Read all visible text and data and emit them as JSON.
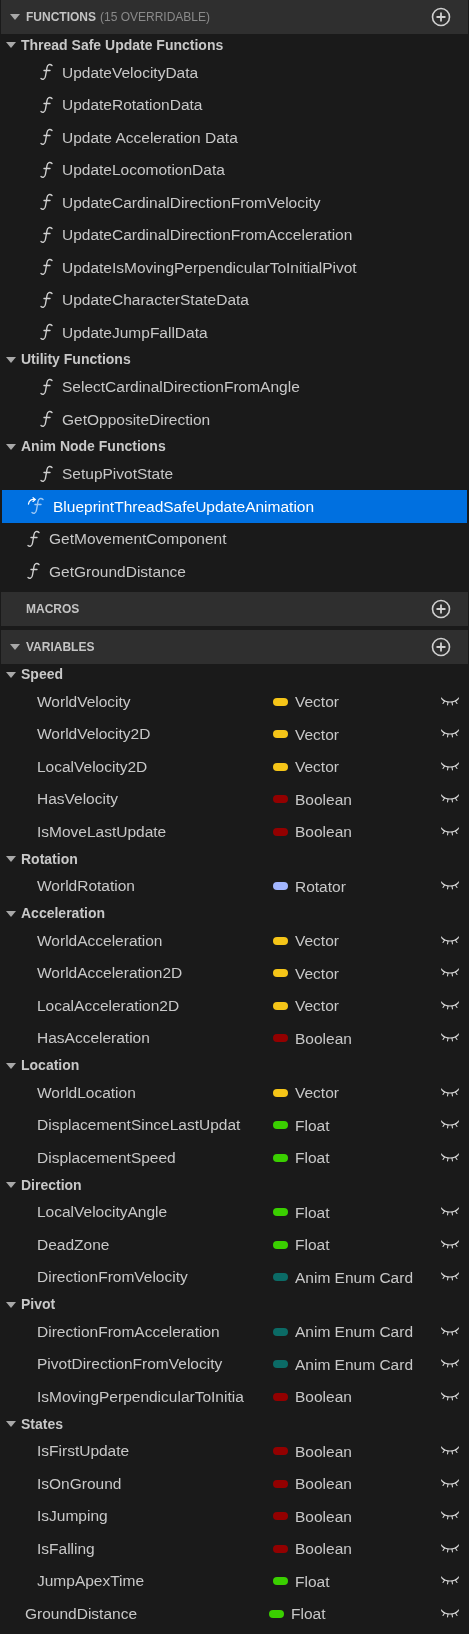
{
  "sections": [
    {
      "kind": "functions",
      "title": "FUNCTIONS",
      "note": "(15 OVERRIDABLE)",
      "expanded": true,
      "categories": [
        {
          "name": "Thread Safe Update Functions",
          "expanded": true,
          "items": [
            {
              "name": "UpdateVelocityData",
              "kind": "function",
              "selected": false
            },
            {
              "name": "UpdateRotationData",
              "kind": "function",
              "selected": false
            },
            {
              "name": "Update Acceleration Data",
              "kind": "function",
              "selected": false
            },
            {
              "name": "UpdateLocomotionData",
              "kind": "function",
              "selected": false
            },
            {
              "name": "UpdateCardinalDirectionFromVelocity",
              "kind": "function",
              "selected": false
            },
            {
              "name": "UpdateCardinalDirectionFromAcceleration",
              "kind": "function",
              "selected": false
            },
            {
              "name": "UpdateIsMovingPerpendicularToInitialPivot",
              "kind": "function",
              "selected": false
            },
            {
              "name": "UpdateCharacterStateData",
              "kind": "function",
              "selected": false
            },
            {
              "name": "UpdateJumpFallData",
              "kind": "function",
              "selected": false
            }
          ]
        },
        {
          "name": "Utility Functions",
          "expanded": true,
          "items": [
            {
              "name": "SelectCardinalDirectionFromAngle",
              "kind": "function",
              "selected": false
            },
            {
              "name": "GetOppositeDirection",
              "kind": "function",
              "selected": false
            }
          ]
        },
        {
          "name": "Anim Node Functions",
          "expanded": true,
          "items": [
            {
              "name": "SetupPivotState",
              "kind": "function",
              "selected": false
            }
          ]
        }
      ],
      "items": [
        {
          "name": "BlueprintThreadSafeUpdateAnimation",
          "kind": "override",
          "selected": true
        },
        {
          "name": "GetMovementComponent",
          "kind": "function",
          "selected": false
        },
        {
          "name": "GetGroundDistance",
          "kind": "function",
          "selected": false
        }
      ]
    },
    {
      "kind": "macros",
      "title": "MACROS",
      "expanded": false
    },
    {
      "kind": "variables",
      "title": "VARIABLES",
      "expanded": true,
      "categories": [
        {
          "name": "Speed",
          "expanded": true,
          "items": [
            {
              "name": "WorldVelocity",
              "type": "Vector",
              "color": "#f5c518"
            },
            {
              "name": "WorldVelocity2D",
              "type": "Vector",
              "color": "#f5c518"
            },
            {
              "name": "LocalVelocity2D",
              "type": "Vector",
              "color": "#f5c518"
            },
            {
              "name": "HasVelocity",
              "type": "Boolean",
              "color": "#930000"
            },
            {
              "name": "IsMoveLastUpdate",
              "type": "Boolean",
              "color": "#930000"
            }
          ]
        },
        {
          "name": "Rotation",
          "expanded": true,
          "items": [
            {
              "name": "WorldRotation",
              "type": "Rotator",
              "color": "#a2b6ff"
            }
          ]
        },
        {
          "name": "Acceleration",
          "expanded": true,
          "items": [
            {
              "name": "WorldAcceleration",
              "type": "Vector",
              "color": "#f5c518"
            },
            {
              "name": "WorldAcceleration2D",
              "type": "Vector",
              "color": "#f5c518"
            },
            {
              "name": "LocalAcceleration2D",
              "type": "Vector",
              "color": "#f5c518"
            },
            {
              "name": "HasAcceleration",
              "type": "Boolean",
              "color": "#930000"
            }
          ]
        },
        {
          "name": "Location",
          "expanded": true,
          "items": [
            {
              "name": "WorldLocation",
              "type": "Vector",
              "color": "#f5c518"
            },
            {
              "name": "DisplacementSinceLastUpdat",
              "type": "Float",
              "color": "#3acf00"
            },
            {
              "name": "DisplacementSpeed",
              "type": "Float",
              "color": "#3acf00"
            }
          ]
        },
        {
          "name": "Direction",
          "expanded": true,
          "items": [
            {
              "name": "LocalVelocityAngle",
              "type": "Float",
              "color": "#3acf00"
            },
            {
              "name": "DeadZone",
              "type": "Float",
              "color": "#3acf00"
            },
            {
              "name": "DirectionFromVelocity",
              "type": "Anim Enum Card",
              "color": "#0b6b66"
            }
          ]
        },
        {
          "name": "Pivot",
          "expanded": true,
          "items": [
            {
              "name": "DirectionFromAcceleration",
              "type": "Anim Enum Card",
              "color": "#0b6b66"
            },
            {
              "name": "PivotDirectionFromVelocity",
              "type": "Anim Enum Card",
              "color": "#0b6b66"
            },
            {
              "name": "IsMovingPerpendicularToInitia",
              "type": "Boolean",
              "color": "#930000"
            }
          ]
        },
        {
          "name": "States",
          "expanded": true,
          "items": [
            {
              "name": "IsFirstUpdate",
              "type": "Boolean",
              "color": "#930000"
            },
            {
              "name": "IsOnGround",
              "type": "Boolean",
              "color": "#930000"
            },
            {
              "name": "IsJumping",
              "type": "Boolean",
              "color": "#930000"
            },
            {
              "name": "IsFalling",
              "type": "Boolean",
              "color": "#930000"
            },
            {
              "name": "JumpApexTime",
              "type": "Float",
              "color": "#3acf00"
            }
          ]
        }
      ],
      "items": [
        {
          "name": "GroundDistance",
          "type": "Float",
          "color": "#3acf00"
        }
      ]
    }
  ]
}
